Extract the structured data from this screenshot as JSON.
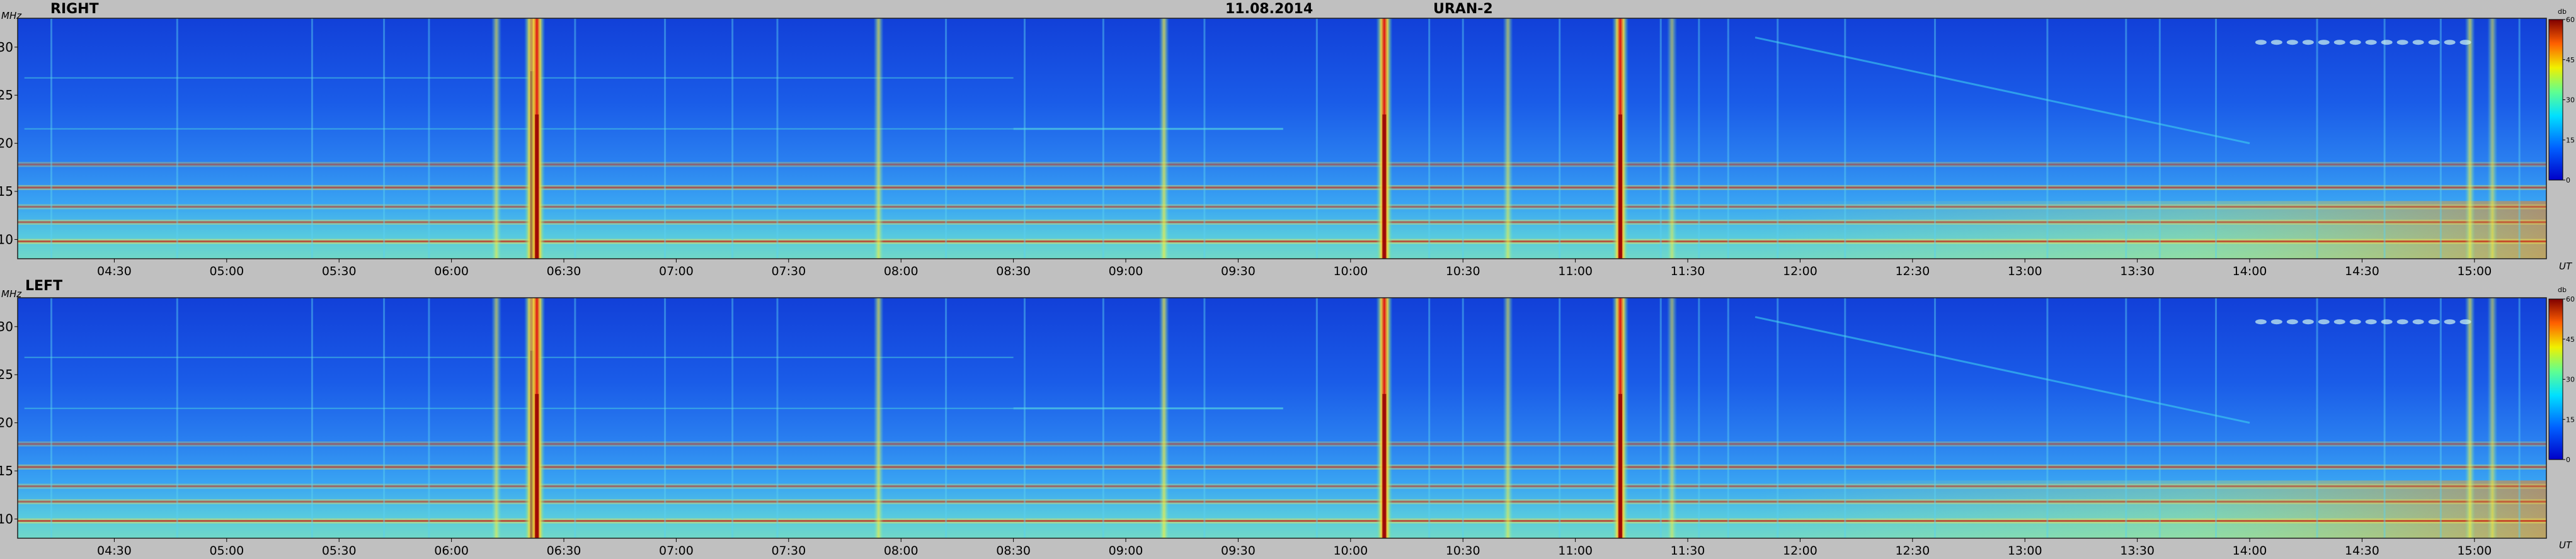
{
  "header": {
    "date": "11.08.2014",
    "instrument": "URAN-2"
  },
  "chart_data": [
    {
      "type": "heatmap",
      "panel_label": "RIGHT",
      "ylabel": "MHz",
      "xlabel": "UT",
      "yticks": [
        "10",
        "15",
        "20",
        "25",
        "30"
      ],
      "xticks": [
        "04:30",
        "05:00",
        "05:30",
        "06:00",
        "06:30",
        "07:00",
        "07:30",
        "08:00",
        "08:30",
        "09:00",
        "09:30",
        "10:00",
        "10:30",
        "11:00",
        "11:30",
        "12:00",
        "12:30",
        "13:00",
        "13:30",
        "14:00",
        "14:30",
        "15:00"
      ],
      "ylim": [
        8,
        33
      ],
      "xlim_hours": [
        4.07,
        15.32
      ],
      "colorbar": {
        "label": "db",
        "ticks": [
          "0",
          "15",
          "30",
          "45",
          "60"
        ],
        "range": [
          0,
          60
        ]
      },
      "features": {
        "bursts": [
          {
            "t": 6.36,
            "intensity": 0.95,
            "span_min": 0.78
          },
          {
            "t": 6.38,
            "intensity": 0.9,
            "span_min": 0.6
          },
          {
            "t": 6.2,
            "intensity": 0.55
          },
          {
            "t": 7.9,
            "intensity": 0.6
          },
          {
            "t": 9.17,
            "intensity": 0.65
          },
          {
            "t": 10.15,
            "intensity": 0.9,
            "span_min": 0.6
          },
          {
            "t": 10.7,
            "intensity": 0.55
          },
          {
            "t": 11.2,
            "intensity": 0.9,
            "span_min": 0.6
          },
          {
            "t": 11.43,
            "intensity": 0.5
          },
          {
            "t": 14.98,
            "intensity": 0.6
          },
          {
            "t": 15.08,
            "intensity": 0.5
          }
        ],
        "bands_mhz": [
          {
            "f": 9.8,
            "intensity": 0.85
          },
          {
            "f": 11.8,
            "intensity": 0.7
          },
          {
            "f": 13.4,
            "intensity": 0.6
          },
          {
            "f": 15.4,
            "intensity": 0.75
          },
          {
            "f": 17.8,
            "intensity": 0.55
          }
        ]
      }
    },
    {
      "type": "heatmap",
      "panel_label": "LEFT",
      "ylabel": "MHz",
      "xlabel": "UT",
      "yticks": [
        "10",
        "15",
        "20",
        "25",
        "30"
      ],
      "xticks": [
        "04:30",
        "05:00",
        "05:30",
        "06:00",
        "06:30",
        "07:00",
        "07:30",
        "08:00",
        "08:30",
        "09:00",
        "09:30",
        "10:00",
        "10:30",
        "11:00",
        "11:30",
        "12:00",
        "12:30",
        "13:00",
        "13:30",
        "14:00",
        "14:30",
        "15:00"
      ],
      "ylim": [
        8,
        33
      ],
      "xlim_hours": [
        4.07,
        15.32
      ],
      "colorbar": {
        "label": "db",
        "ticks": [
          "0",
          "15",
          "30",
          "45",
          "60"
        ],
        "range": [
          0,
          60
        ]
      },
      "features": {
        "bursts": [
          {
            "t": 6.36,
            "intensity": 0.95,
            "span_min": 0.78
          },
          {
            "t": 6.38,
            "intensity": 0.9,
            "span_min": 0.6
          },
          {
            "t": 6.2,
            "intensity": 0.55
          },
          {
            "t": 7.9,
            "intensity": 0.6
          },
          {
            "t": 9.17,
            "intensity": 0.65
          },
          {
            "t": 10.15,
            "intensity": 0.9,
            "span_min": 0.6
          },
          {
            "t": 10.7,
            "intensity": 0.55
          },
          {
            "t": 11.2,
            "intensity": 0.9,
            "span_min": 0.6
          },
          {
            "t": 11.43,
            "intensity": 0.5
          },
          {
            "t": 14.98,
            "intensity": 0.6
          },
          {
            "t": 15.08,
            "intensity": 0.5
          }
        ],
        "bands_mhz": [
          {
            "f": 9.8,
            "intensity": 0.85
          },
          {
            "f": 11.8,
            "intensity": 0.7
          },
          {
            "f": 13.4,
            "intensity": 0.6
          },
          {
            "f": 15.4,
            "intensity": 0.75
          },
          {
            "f": 17.8,
            "intensity": 0.55
          }
        ]
      }
    }
  ]
}
